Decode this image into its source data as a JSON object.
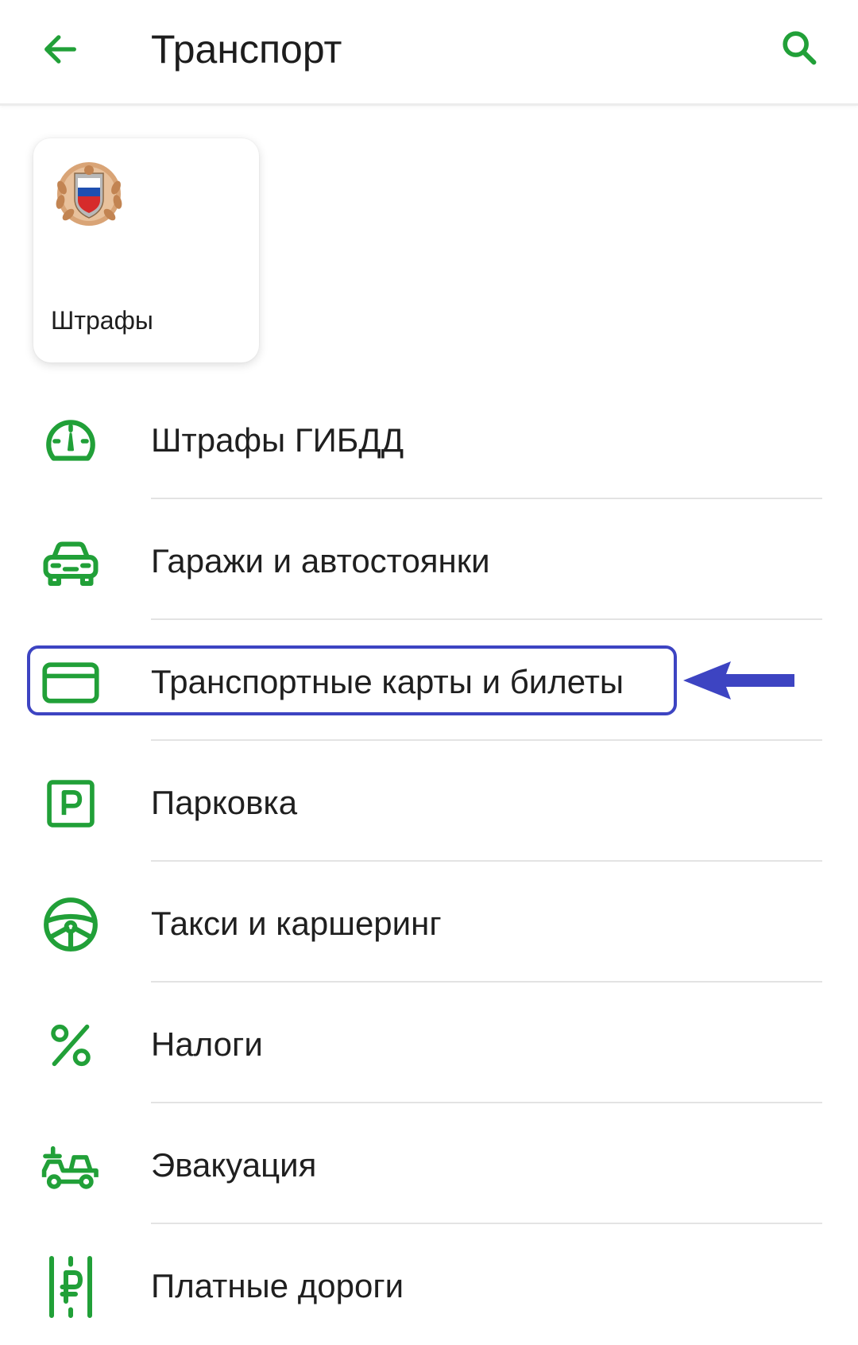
{
  "header": {
    "title": "Транспорт",
    "back_icon": "arrow-left-icon",
    "search_icon": "search-icon"
  },
  "tile": {
    "label": "Штрафы",
    "icon": "gibdd-emblem-icon"
  },
  "menu": {
    "items": [
      {
        "label": "Штрафы ГИБДД",
        "icon": "speedometer-icon"
      },
      {
        "label": "Гаражи и автостоянки",
        "icon": "car-icon"
      },
      {
        "label": "Транспортные карты и билеты",
        "icon": "card-icon"
      },
      {
        "label": "Парковка",
        "icon": "parking-icon"
      },
      {
        "label": "Такси и каршеринг",
        "icon": "steering-wheel-icon"
      },
      {
        "label": "Налоги",
        "icon": "percent-icon"
      },
      {
        "label": "Эвакуация",
        "icon": "tow-truck-icon"
      },
      {
        "label": "Платные дороги",
        "icon": "toll-road-icon"
      }
    ]
  },
  "colors": {
    "accent": "#21a038",
    "highlight": "#3d44c2",
    "divider": "#e3e3e3"
  }
}
